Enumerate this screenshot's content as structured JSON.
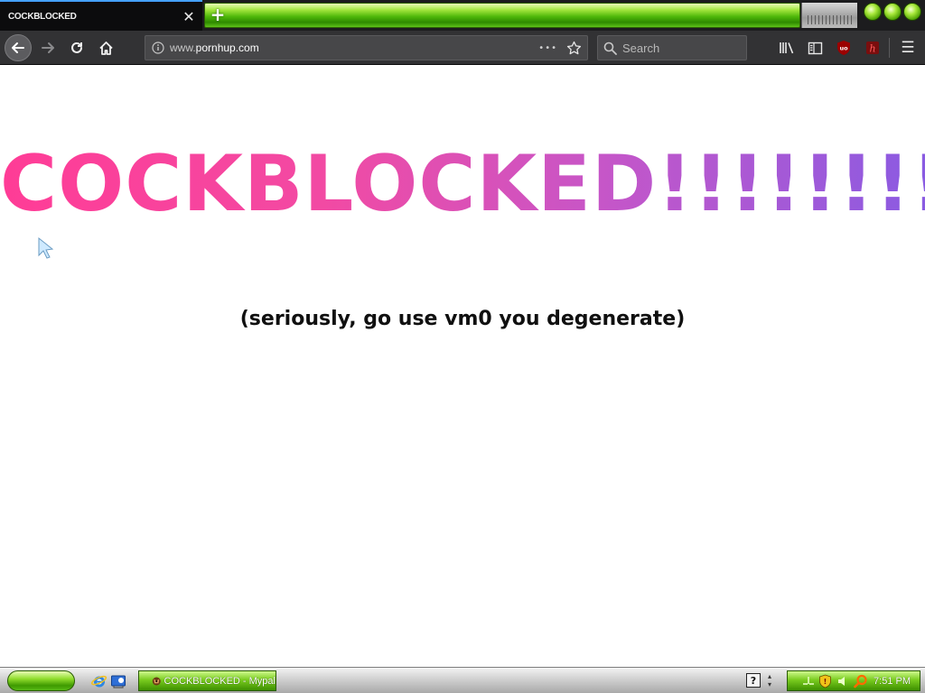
{
  "tab": {
    "title": "COCKBLOCKED",
    "close_glyph": "✕"
  },
  "tabstrip": {
    "newtab_glyph": "+"
  },
  "nav": {
    "url_prefix": "www.",
    "url_domain": "pornhup.com",
    "page_actions_glyph": "•••",
    "search_placeholder": "Search",
    "menu_glyph": "☰"
  },
  "content": {
    "headline": "COCKBLOCKED!!!!!!!!",
    "subline": "(seriously, go use vm0 you degenerate)"
  },
  "taskbar": {
    "task_label": "COCKBLOCKED - Mypal",
    "help_glyph": "?",
    "clock": "7:51 PM"
  },
  "colors": {
    "accent": "#45a1ff",
    "headline_start": "#ff3c96",
    "headline_end": "#8a5be2",
    "theme_green": "#4fb80a"
  }
}
